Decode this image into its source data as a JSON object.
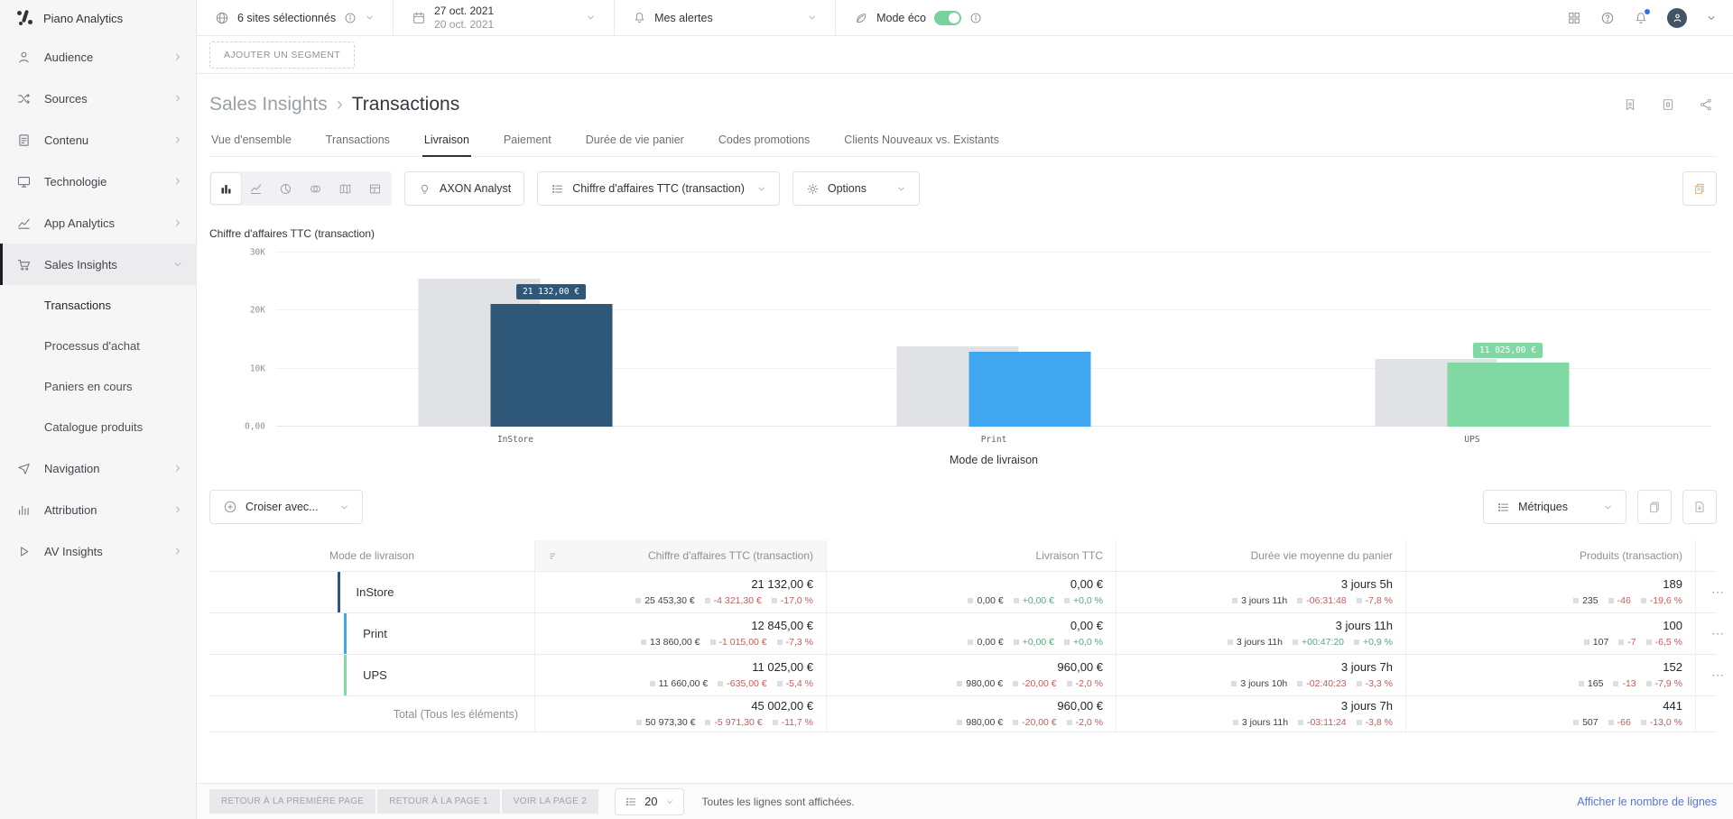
{
  "brand": {
    "name": "Piano Analytics"
  },
  "sidebar": {
    "items": [
      {
        "label": "Audience"
      },
      {
        "label": "Sources"
      },
      {
        "label": "Contenu"
      },
      {
        "label": "Technologie"
      },
      {
        "label": "App Analytics"
      },
      {
        "label": "Sales Insights"
      },
      {
        "label": "Navigation"
      },
      {
        "label": "Attribution"
      },
      {
        "label": "AV Insights"
      }
    ],
    "sales_subitems": [
      {
        "label": "Transactions"
      },
      {
        "label": "Processus d'achat"
      },
      {
        "label": "Paniers en cours"
      },
      {
        "label": "Catalogue produits"
      }
    ]
  },
  "topbar": {
    "sites": "6 sites sélectionnés",
    "date_line1": "27 oct. 2021",
    "date_line2": "20 oct. 2021",
    "alerts": "Mes alertes",
    "eco_label": "Mode éco",
    "eco_on": true
  },
  "segment": {
    "add_button": "AJOUTER UN SEGMENT"
  },
  "page": {
    "breadcrumb_parent": "Sales Insights",
    "breadcrumb_sep": "›",
    "breadcrumb_current": "Transactions"
  },
  "tabs": [
    {
      "label": "Vue d'ensemble"
    },
    {
      "label": "Transactions"
    },
    {
      "label": "Livraison"
    },
    {
      "label": "Paiement"
    },
    {
      "label": "Durée de vie panier"
    },
    {
      "label": "Codes promotions"
    },
    {
      "label": "Clients Nouveaux vs. Existants"
    }
  ],
  "toolbar": {
    "axon": "AXON Analyst",
    "metric_dropdown": "Chiffre d'affaires TTC (transaction)",
    "options": "Options"
  },
  "chart_data": {
    "type": "bar",
    "title": "Chiffre d'affaires TTC (transaction)",
    "xlabel": "Mode de livraison",
    "categories": [
      "InStore",
      "Print",
      "UPS"
    ],
    "series": [
      {
        "name": "période précédente",
        "color": "#e1e2e5",
        "values": [
          25453.3,
          13860.0,
          11660.0
        ]
      },
      {
        "name": "période actuelle",
        "colors": [
          "#2f5878",
          "#41a6f0",
          "#80d8a3"
        ],
        "values": [
          21132.0,
          12845.0,
          11025.0
        ]
      }
    ],
    "value_labels": [
      {
        "text": "21 132,00 €",
        "color": "#2f5878"
      },
      null,
      {
        "text": "11 025,00 €",
        "color": "#80d8a3"
      }
    ],
    "ylim": [
      0,
      30000
    ],
    "yticks": [
      {
        "value": 0,
        "label": "0,00"
      },
      {
        "value": 10000,
        "label": "10K"
      },
      {
        "value": 20000,
        "label": "20K"
      },
      {
        "value": 30000,
        "label": "30K"
      }
    ],
    "grid": true,
    "legend_position": "none"
  },
  "crossing": {
    "button": "Croiser avec..."
  },
  "metrics_dropdown": {
    "label": "Métriques"
  },
  "table": {
    "columns": [
      {
        "label": "Mode de livraison"
      },
      {
        "label": "Chiffre d'affaires TTC (transaction)"
      },
      {
        "label": "Livraison TTC"
      },
      {
        "label": "Durée vie moyenne du panier"
      },
      {
        "label": "Produits (transaction)"
      }
    ],
    "ellipsis": "⋯",
    "rows": [
      {
        "name": "InStore",
        "color": "#2f5878",
        "metrics": [
          {
            "main": "21 132,00 €",
            "prev": "25 453,30 €",
            "delta": "-4 321,30 €",
            "pct": "-17,0 %",
            "trend": "trend-neg"
          },
          {
            "main": "0,00 €",
            "prev": "0,00 €",
            "delta": "+0,00 €",
            "pct": "+0,0 %",
            "trend": "trend-pos"
          },
          {
            "main": "3 jours 5h",
            "prev": "3 jours 11h",
            "delta": "-06:31:48",
            "pct": "-7,8 %",
            "trend": "trend-neg"
          },
          {
            "main": "189",
            "prev": "235",
            "delta": "-46",
            "pct": "-19,6 %",
            "trend": "trend-neg"
          }
        ]
      },
      {
        "name": "Print",
        "color": "#41a6f0",
        "metrics": [
          {
            "main": "12 845,00 €",
            "prev": "13 860,00 €",
            "delta": "-1 015,00 €",
            "pct": "-7,3 %",
            "trend": "trend-neg"
          },
          {
            "main": "0,00 €",
            "prev": "0,00 €",
            "delta": "+0,00 €",
            "pct": "+0,0 %",
            "trend": "trend-pos"
          },
          {
            "main": "3 jours 11h",
            "prev": "3 jours 11h",
            "delta": "+00:47:20",
            "pct": "+0,9 %",
            "trend": "trend-pos"
          },
          {
            "main": "100",
            "prev": "107",
            "delta": "-7",
            "pct": "-6,5 %",
            "trend": "trend-neg"
          }
        ]
      },
      {
        "name": "UPS",
        "color": "#80d8a3",
        "metrics": [
          {
            "main": "11 025,00 €",
            "prev": "11 660,00 €",
            "delta": "-635,00 €",
            "pct": "-5,4 %",
            "trend": "trend-neg"
          },
          {
            "main": "960,00 €",
            "prev": "980,00 €",
            "delta": "-20,00 €",
            "pct": "-2,0 %",
            "trend": "trend-neg"
          },
          {
            "main": "3 jours 7h",
            "prev": "3 jours 10h",
            "delta": "-02:40:23",
            "pct": "-3,3 %",
            "trend": "trend-neg"
          },
          {
            "main": "152",
            "prev": "165",
            "delta": "-13",
            "pct": "-7,9 %",
            "trend": "trend-neg"
          }
        ]
      }
    ],
    "total": {
      "name": "Total (Tous les éléments)",
      "metrics": [
        {
          "main": "45 002,00 €",
          "prev": "50 973,30 €",
          "delta": "-5 971,30 €",
          "pct": "-11,7 %",
          "trend": "trend-neg"
        },
        {
          "main": "960,00 €",
          "prev": "980,00 €",
          "delta": "-20,00 €",
          "pct": "-2,0 %",
          "trend": "trend-neg"
        },
        {
          "main": "3 jours 7h",
          "prev": "3 jours 11h",
          "delta": "-03:11:24",
          "pct": "-3,8 %",
          "trend": "trend-neg"
        },
        {
          "main": "441",
          "prev": "507",
          "delta": "-66",
          "pct": "-13,0 %",
          "trend": "trend-neg"
        }
      ]
    }
  },
  "footer": {
    "first_page": "RETOUR À LA PREMIÈRE PAGE",
    "page1": "RETOUR À LA PAGE 1",
    "page2": "VOIR LA PAGE 2",
    "rows_per_page": "20",
    "status": "Toutes les lignes sont affichées.",
    "link": "Afficher le nombre de lignes"
  }
}
